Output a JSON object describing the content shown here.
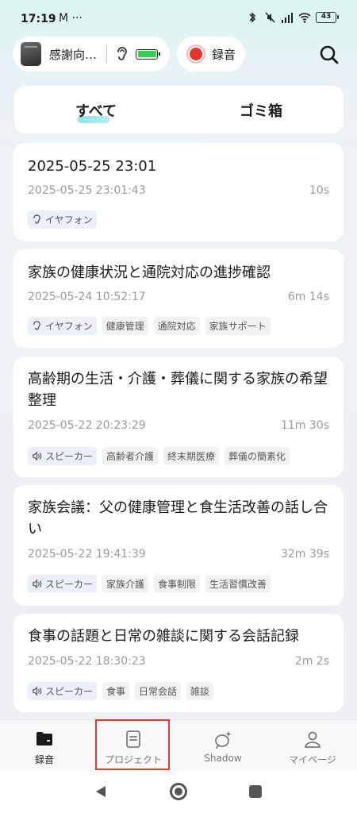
{
  "status_bar": {
    "time": "17:19",
    "notification_icons": "M ···",
    "battery": "43"
  },
  "header": {
    "device_name": "感謝向…",
    "record_label": "録音",
    "record_color": "#e8322d"
  },
  "tabs": {
    "all": "すべて",
    "trash": "ゴミ箱",
    "active": "すべて"
  },
  "recordings": [
    {
      "title": "2025-05-25 23:01",
      "date": "2025-05-25 23:01:43",
      "duration": "10s",
      "source": "イヤフォン",
      "source_icon": "ear-icon",
      "tags": []
    },
    {
      "title": "家族の健康状況と通院対応の進捗確認",
      "date": "2025-05-24 10:52:17",
      "duration": "6m 14s",
      "source": "イヤフォン",
      "source_icon": "ear-icon",
      "tags": [
        "健康管理",
        "通院対応",
        "家族サポート"
      ]
    },
    {
      "title": "高齢期の生活・介護・葬儀に関する家族の希望整理",
      "date": "2025-05-22 20:23:29",
      "duration": "11m 30s",
      "source": "スピーカー",
      "source_icon": "speaker-icon",
      "tags": [
        "高齢者介護",
        "終末期医療",
        "葬儀の簡素化"
      ]
    },
    {
      "title": "家族会議：父の健康管理と食生活改善の話し合い",
      "date": "2025-05-22 19:41:39",
      "duration": "32m 39s",
      "source": "スピーカー",
      "source_icon": "speaker-icon",
      "tags": [
        "家族介護",
        "食事制限",
        "生活習慣改善"
      ]
    },
    {
      "title": "食事の話題と日常の雑談に関する会話記録",
      "date": "2025-05-22 18:30:23",
      "duration": "2m 2s",
      "source": "スピーカー",
      "source_icon": "speaker-icon",
      "tags": [
        "食事",
        "日常会話",
        "雑談"
      ]
    }
  ],
  "bottom_nav": [
    {
      "label": "録音",
      "icon": "folder-icon",
      "active": true
    },
    {
      "label": "プロジェクト",
      "icon": "document-icon",
      "active": false
    },
    {
      "label": "Shadow",
      "icon": "shadow-icon",
      "active": false
    },
    {
      "label": "マイページ",
      "icon": "person-icon",
      "active": false
    }
  ],
  "highlight_color": "#e53b2c"
}
